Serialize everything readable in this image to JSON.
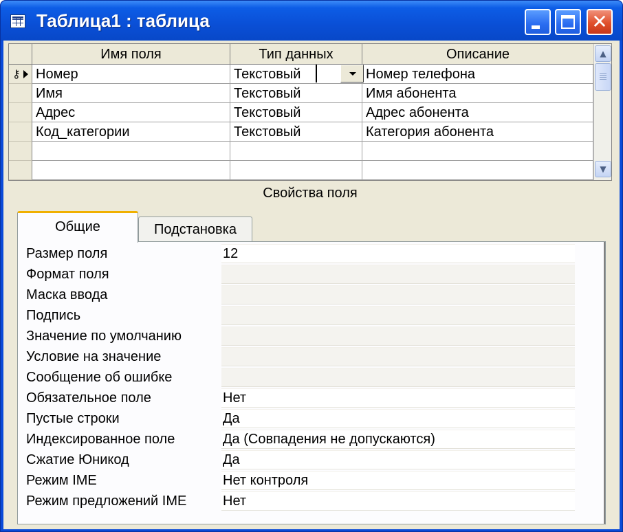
{
  "window": {
    "title": "Таблица1 : таблица",
    "icons": {
      "app": "table-icon",
      "minimize": "minimize-icon",
      "maximize": "maximize-icon",
      "close": "close-icon"
    },
    "close_glyph": "✕"
  },
  "grid": {
    "columns": [
      "Имя поля",
      "Тип данных",
      "Описание"
    ],
    "rows": [
      {
        "name": "Номер",
        "type": "Текстовый",
        "description": "Номер телефона",
        "primary_key": true
      },
      {
        "name": "Имя",
        "type": "Текстовый",
        "description": "Имя абонента"
      },
      {
        "name": "Адрес",
        "type": "Текстовый",
        "description": "Адрес абонента"
      },
      {
        "name": "Код_категории",
        "type": "Текстовый",
        "description": "Категория абонента"
      },
      {
        "name": "",
        "type": "",
        "description": ""
      },
      {
        "name": "",
        "type": "",
        "description": ""
      }
    ],
    "scroll_up": "▲",
    "scroll_down": "▼",
    "key_glyph": "⚷"
  },
  "field_properties": {
    "title": "Свойства поля",
    "tabs": [
      {
        "label": "Общие",
        "active": true
      },
      {
        "label": "Подстановка",
        "active": false
      }
    ],
    "properties": [
      {
        "label": "Размер поля",
        "value": "12"
      },
      {
        "label": "Формат поля",
        "value": ""
      },
      {
        "label": "Маска ввода",
        "value": ""
      },
      {
        "label": "Подпись",
        "value": ""
      },
      {
        "label": "Значение по умолчанию",
        "value": ""
      },
      {
        "label": "Условие на значение",
        "value": ""
      },
      {
        "label": "Сообщение об ошибке",
        "value": ""
      },
      {
        "label": "Обязательное поле",
        "value": "Нет"
      },
      {
        "label": "Пустые строки",
        "value": "Да"
      },
      {
        "label": "Индексированное поле",
        "value": "Да (Совпадения не допускаются)"
      },
      {
        "label": "Сжатие Юникод",
        "value": "Да"
      },
      {
        "label": "Режим IME",
        "value": "Нет контроля"
      },
      {
        "label": "Режим предложений IME",
        "value": "Нет"
      }
    ]
  },
  "colors": {
    "titlebar": "#0a4fd6",
    "window_face": "#ece9d8",
    "close_button": "#e0502c",
    "active_tab_accent": "#f0b000"
  }
}
